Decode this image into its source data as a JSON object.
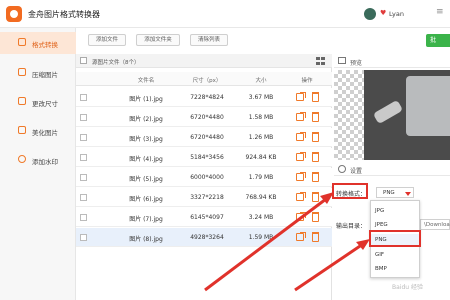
{
  "app": {
    "title": "金舟图片格式转换器",
    "user": "Lyan",
    "menu_glyph": "≡"
  },
  "sidebar": {
    "items": [
      {
        "label": "格式转换",
        "active": true
      },
      {
        "label": "压缩图片",
        "active": false
      },
      {
        "label": "更改尺寸",
        "active": false
      },
      {
        "label": "美化图片",
        "active": false
      },
      {
        "label": "添加水印",
        "active": false
      }
    ]
  },
  "toolbar": {
    "add_file": "添加文件",
    "add_folder": "添加文件夹",
    "clear_list": "清除列表",
    "start": "批"
  },
  "filelist": {
    "header": "源图片文件（8个）",
    "columns": [
      "文件名",
      "尺寸（px）",
      "大小",
      "操作"
    ],
    "rows": [
      {
        "name": "图片 (1).jpg",
        "size_px": "7228*4824",
        "size": "3.67 MB"
      },
      {
        "name": "图片 (2).jpg",
        "size_px": "6720*4480",
        "size": "1.58 MB"
      },
      {
        "name": "图片 (3).jpg",
        "size_px": "6720*4480",
        "size": "1.26 MB"
      },
      {
        "name": "图片 (4).jpg",
        "size_px": "5184*3456",
        "size": "924.84 KB"
      },
      {
        "name": "图片 (5).jpg",
        "size_px": "6000*4000",
        "size": "1.79 MB"
      },
      {
        "name": "图片 (6).jpg",
        "size_px": "3327*2218",
        "size": "768.94 KB"
      },
      {
        "name": "图片 (7).jpg",
        "size_px": "6145*4097",
        "size": "3.24 MB"
      },
      {
        "name": "图片 (8).jpg",
        "size_px": "4928*3264",
        "size": "1.59 MB"
      }
    ]
  },
  "preview": {
    "label": "预览"
  },
  "settings": {
    "label": "设置",
    "format_label": "转换格式：",
    "format_value": "PNG",
    "output_label": "输出目录：",
    "output_value": "\\Downloa",
    "options": [
      "JPG",
      "JPEG",
      "PNG",
      "GIF",
      "BMP"
    ]
  },
  "watermark": "Baidu 经验",
  "colors": {
    "accent": "#f07a2a",
    "highlight": "#e0322b",
    "start": "#3bb34a"
  }
}
